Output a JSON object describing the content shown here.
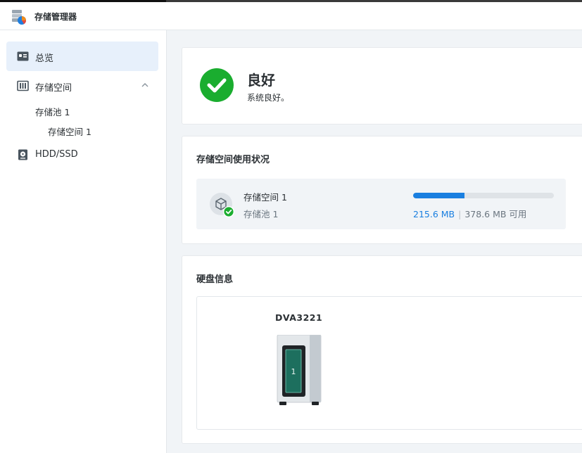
{
  "app": {
    "title": "存储管理器",
    "icon": "storage-manager-icon"
  },
  "sidebar": {
    "items": [
      {
        "label": "总览",
        "icon": "overview-icon",
        "active": true
      },
      {
        "label": "存储空间",
        "icon": "storage-space-icon",
        "expanded": true
      },
      {
        "label": "HDD/SSD",
        "icon": "hdd-icon"
      }
    ],
    "pool_label": "存储池 1",
    "volume_label": "存储空间 1"
  },
  "status": {
    "title": "良好",
    "description": "系统良好。",
    "color": "#1aad2f"
  },
  "usage": {
    "section_title": "存储空间使用状况",
    "volume_name": "存储空间 1",
    "pool_name": "存储池 1",
    "used": "215.6 MB",
    "separator": "|",
    "available_text": "378.6 MB 可用",
    "used_fraction": 0.365,
    "bar_color": "#1a7fe0"
  },
  "disk": {
    "section_title": "硬盘信息",
    "model": "DVA3221",
    "bay_number": "1"
  }
}
